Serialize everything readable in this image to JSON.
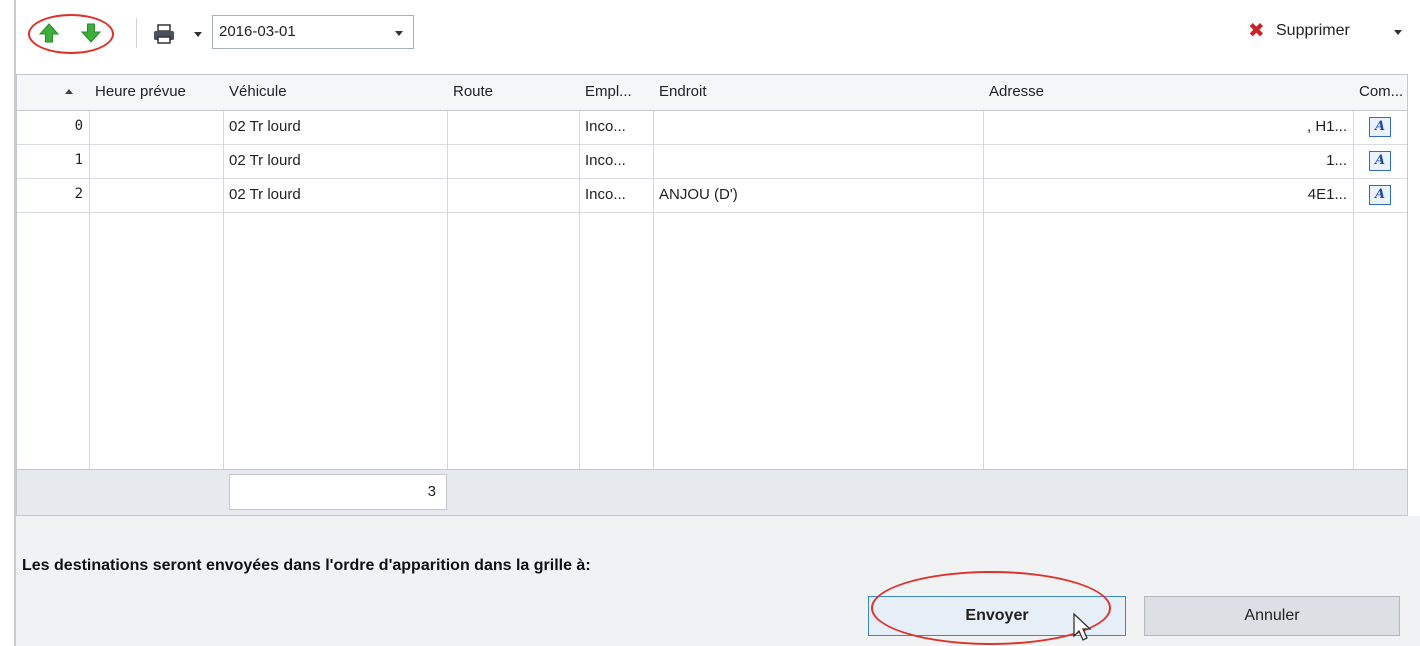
{
  "toolbar": {
    "move_up_icon": "arrow-up-icon",
    "move_down_icon": "arrow-down-icon",
    "printer_icon": "printer-icon",
    "date_value": "2016-03-01",
    "delete_label": "Supprimer",
    "delete_icon": "close-icon",
    "accent_green": "#3cae3a",
    "delete_red": "#c8252b"
  },
  "grid": {
    "columns": [
      "Heure prévue",
      "Véhicule",
      "Route",
      "Empl...",
      "Endroit",
      "Adresse",
      "Com..."
    ],
    "sort_column": "index",
    "sort_direction": "ascending",
    "rows": [
      {
        "index": "0",
        "heure": "",
        "vehicule": "02  Tr lourd",
        "route": "",
        "empl": "Inco...",
        "endroit": "",
        "adresse": ", H1...",
        "comment_icon": "text-edit-icon"
      },
      {
        "index": "1",
        "heure": "",
        "vehicule": "02  Tr lourd",
        "route": "",
        "empl": "Inco...",
        "endroit": "",
        "adresse": "1...",
        "comment_icon": "text-edit-icon"
      },
      {
        "index": "2",
        "heure": "",
        "vehicule": "02  Tr lourd",
        "route": "",
        "empl": "Inco...",
        "endroit": "ANJOU (D')",
        "adresse": "4E1...",
        "comment_icon": "text-edit-icon"
      }
    ],
    "footer_count": "3"
  },
  "bottom": {
    "message": "Les destinations seront envoyées dans l'ordre d'apparition dans la grille à:",
    "send_label": "Envoyer",
    "cancel_label": "Annuler",
    "annotation_color": "#e0302a"
  }
}
